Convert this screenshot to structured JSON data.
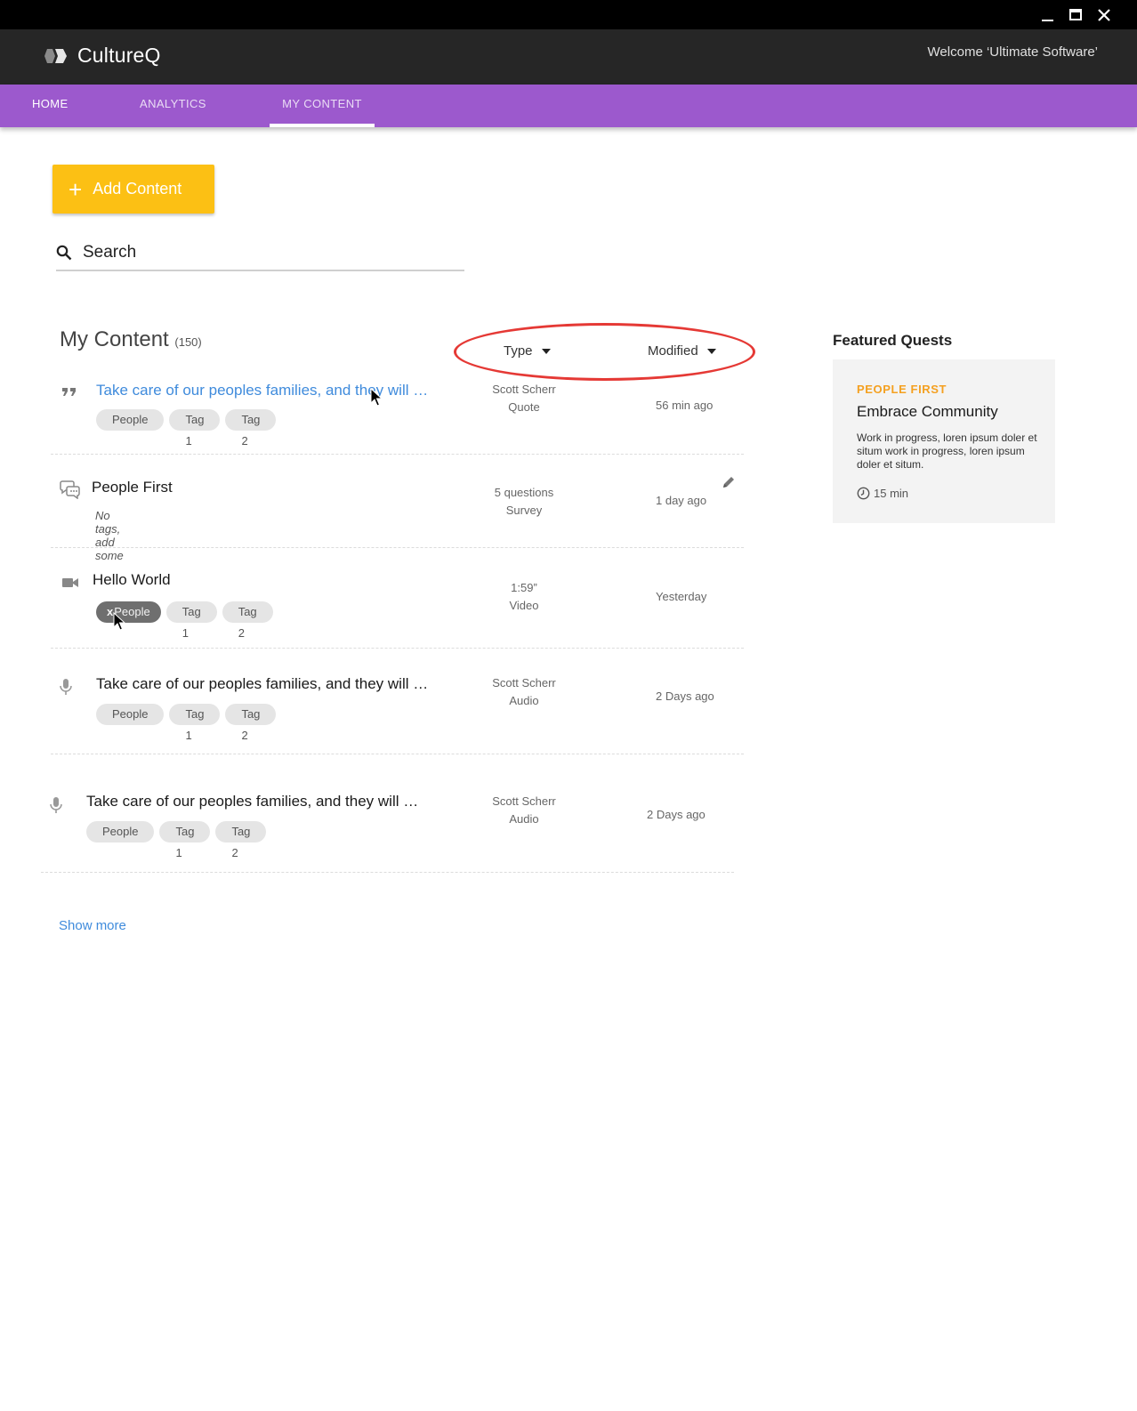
{
  "window": {
    "controls": [
      "minimize-icon",
      "maximize-icon",
      "close-icon"
    ]
  },
  "app": {
    "name": "CultureQ",
    "welcome": "Welcome ‘Ultimate Software’"
  },
  "nav": {
    "tabs": [
      {
        "label": "HOME"
      },
      {
        "label": "ANALYTICS"
      },
      {
        "label": "MY CONTENT",
        "selected": true
      }
    ]
  },
  "toolbar": {
    "add_label": "Add Content",
    "search_placeholder": "Search"
  },
  "content": {
    "title": "My Content",
    "count": "(150)",
    "sort": {
      "type_label": "Type",
      "modified_label": "Modified"
    },
    "rows": [
      {
        "icon": "quote-icon",
        "title": "Take care of our peoples families, and they will …",
        "tags": [
          "People",
          "Tag 1",
          "Tag 2"
        ],
        "meta_line1": "Scott Scherr",
        "meta_line2": "Quote",
        "modified": "56 min ago"
      },
      {
        "icon": "survey-icon",
        "title": "People First",
        "no_tags": "No tags, add some",
        "meta_line1": "5 questions",
        "meta_line2": "Survey",
        "modified": "1 day ago"
      },
      {
        "icon": "video-icon",
        "title": "Hello World",
        "tags": [
          "People",
          "Tag 1",
          "Tag 2"
        ],
        "remove_mark": "x",
        "meta_line1": "1:59”",
        "meta_line2": "Video",
        "modified": "Yesterday"
      },
      {
        "icon": "microphone-icon",
        "title": "Take care of our peoples families, and they will …",
        "tags": [
          "People",
          "Tag 1",
          "Tag 2"
        ],
        "meta_line1": "Scott Scherr",
        "meta_line2": "Audio",
        "modified": "2 Days ago"
      },
      {
        "icon": "microphone-icon",
        "title": "Take care of our peoples families, and they will …",
        "tags": [
          "People",
          "Tag 1",
          "Tag 2"
        ],
        "meta_line1": "Scott Scherr",
        "meta_line2": "Audio",
        "modified": "2 Days ago"
      }
    ],
    "show_more": "Show more"
  },
  "featured": {
    "title": "Featured Quests",
    "card": {
      "kicker": "PEOPLE FIRST",
      "title": "Embrace Community",
      "description": "Work in progress, loren ipsum doler et situm work in progress, loren ipsum doler et situm.",
      "duration": "15 min"
    }
  },
  "colors": {
    "nav_purple": "#9c59cd",
    "accent_yellow": "#fcc014",
    "link_blue": "#3f8bdc",
    "kicker_orange": "#f4a020",
    "annotation_red": "#e53935"
  }
}
